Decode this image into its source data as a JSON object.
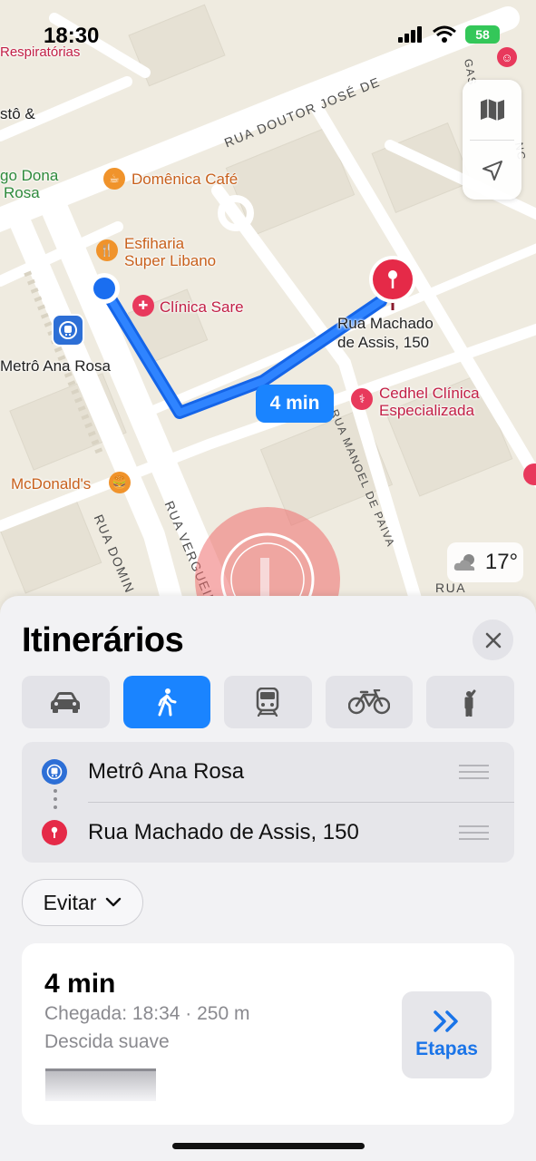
{
  "status_bar": {
    "time": "18:30",
    "battery": "58"
  },
  "map": {
    "labels": {
      "respiratorias": "Respiratórias",
      "gosto": "stô &",
      "jogo_dona": "go Dona",
      "rosa": "Rosa",
      "domenica": "Domênica Café",
      "esfiharia_1": "Esfiharia",
      "esfiharia_2": "Super Libano",
      "clinica_sare": "Clínica Sare",
      "metro": "Metrô Ana Rosa",
      "destination_1": "Rua Machado",
      "destination_2": "de Assis, 150",
      "cedhel_1": "Cedhel Clínica",
      "cedhel_2": "Especializada",
      "mcdonalds": "McDonald's"
    },
    "streets": {
      "doutor_jose": "RUA DOUTOR JOSÉ DE",
      "vergueiro": "RUA VERGUEIR",
      "domin": "RUA DOMIN",
      "manoel": "RUA MANOEL DE PAIVA",
      "rua_top": "RUA",
      "gas": "GAS",
      "nc": "NC"
    },
    "eta_bubble": "4 min",
    "weather": "17°"
  },
  "sheet": {
    "title": "Itinerários",
    "modes": [
      {
        "id": "car",
        "icon": "car-icon",
        "active": false
      },
      {
        "id": "walk",
        "icon": "walk-icon",
        "active": true
      },
      {
        "id": "transit",
        "icon": "train-icon",
        "active": false
      },
      {
        "id": "bike",
        "icon": "bike-icon",
        "active": false
      },
      {
        "id": "ride",
        "icon": "person-hail-icon",
        "active": false
      }
    ],
    "route": {
      "origin": "Metrô Ana Rosa",
      "destination": "Rua Machado de Assis, 150"
    },
    "avoid_label": "Evitar",
    "result": {
      "duration": "4 min",
      "arrival": "Chegada: 18:34 · 250 m",
      "description": "Descida suave",
      "steps_label": "Etapas"
    }
  },
  "colors": {
    "accent": "#1a84ff",
    "pin_red": "#e52a48",
    "metro_blue": "#2d6fd6",
    "poi_orange": "#f0932b",
    "poi_red": "#e8395c"
  }
}
